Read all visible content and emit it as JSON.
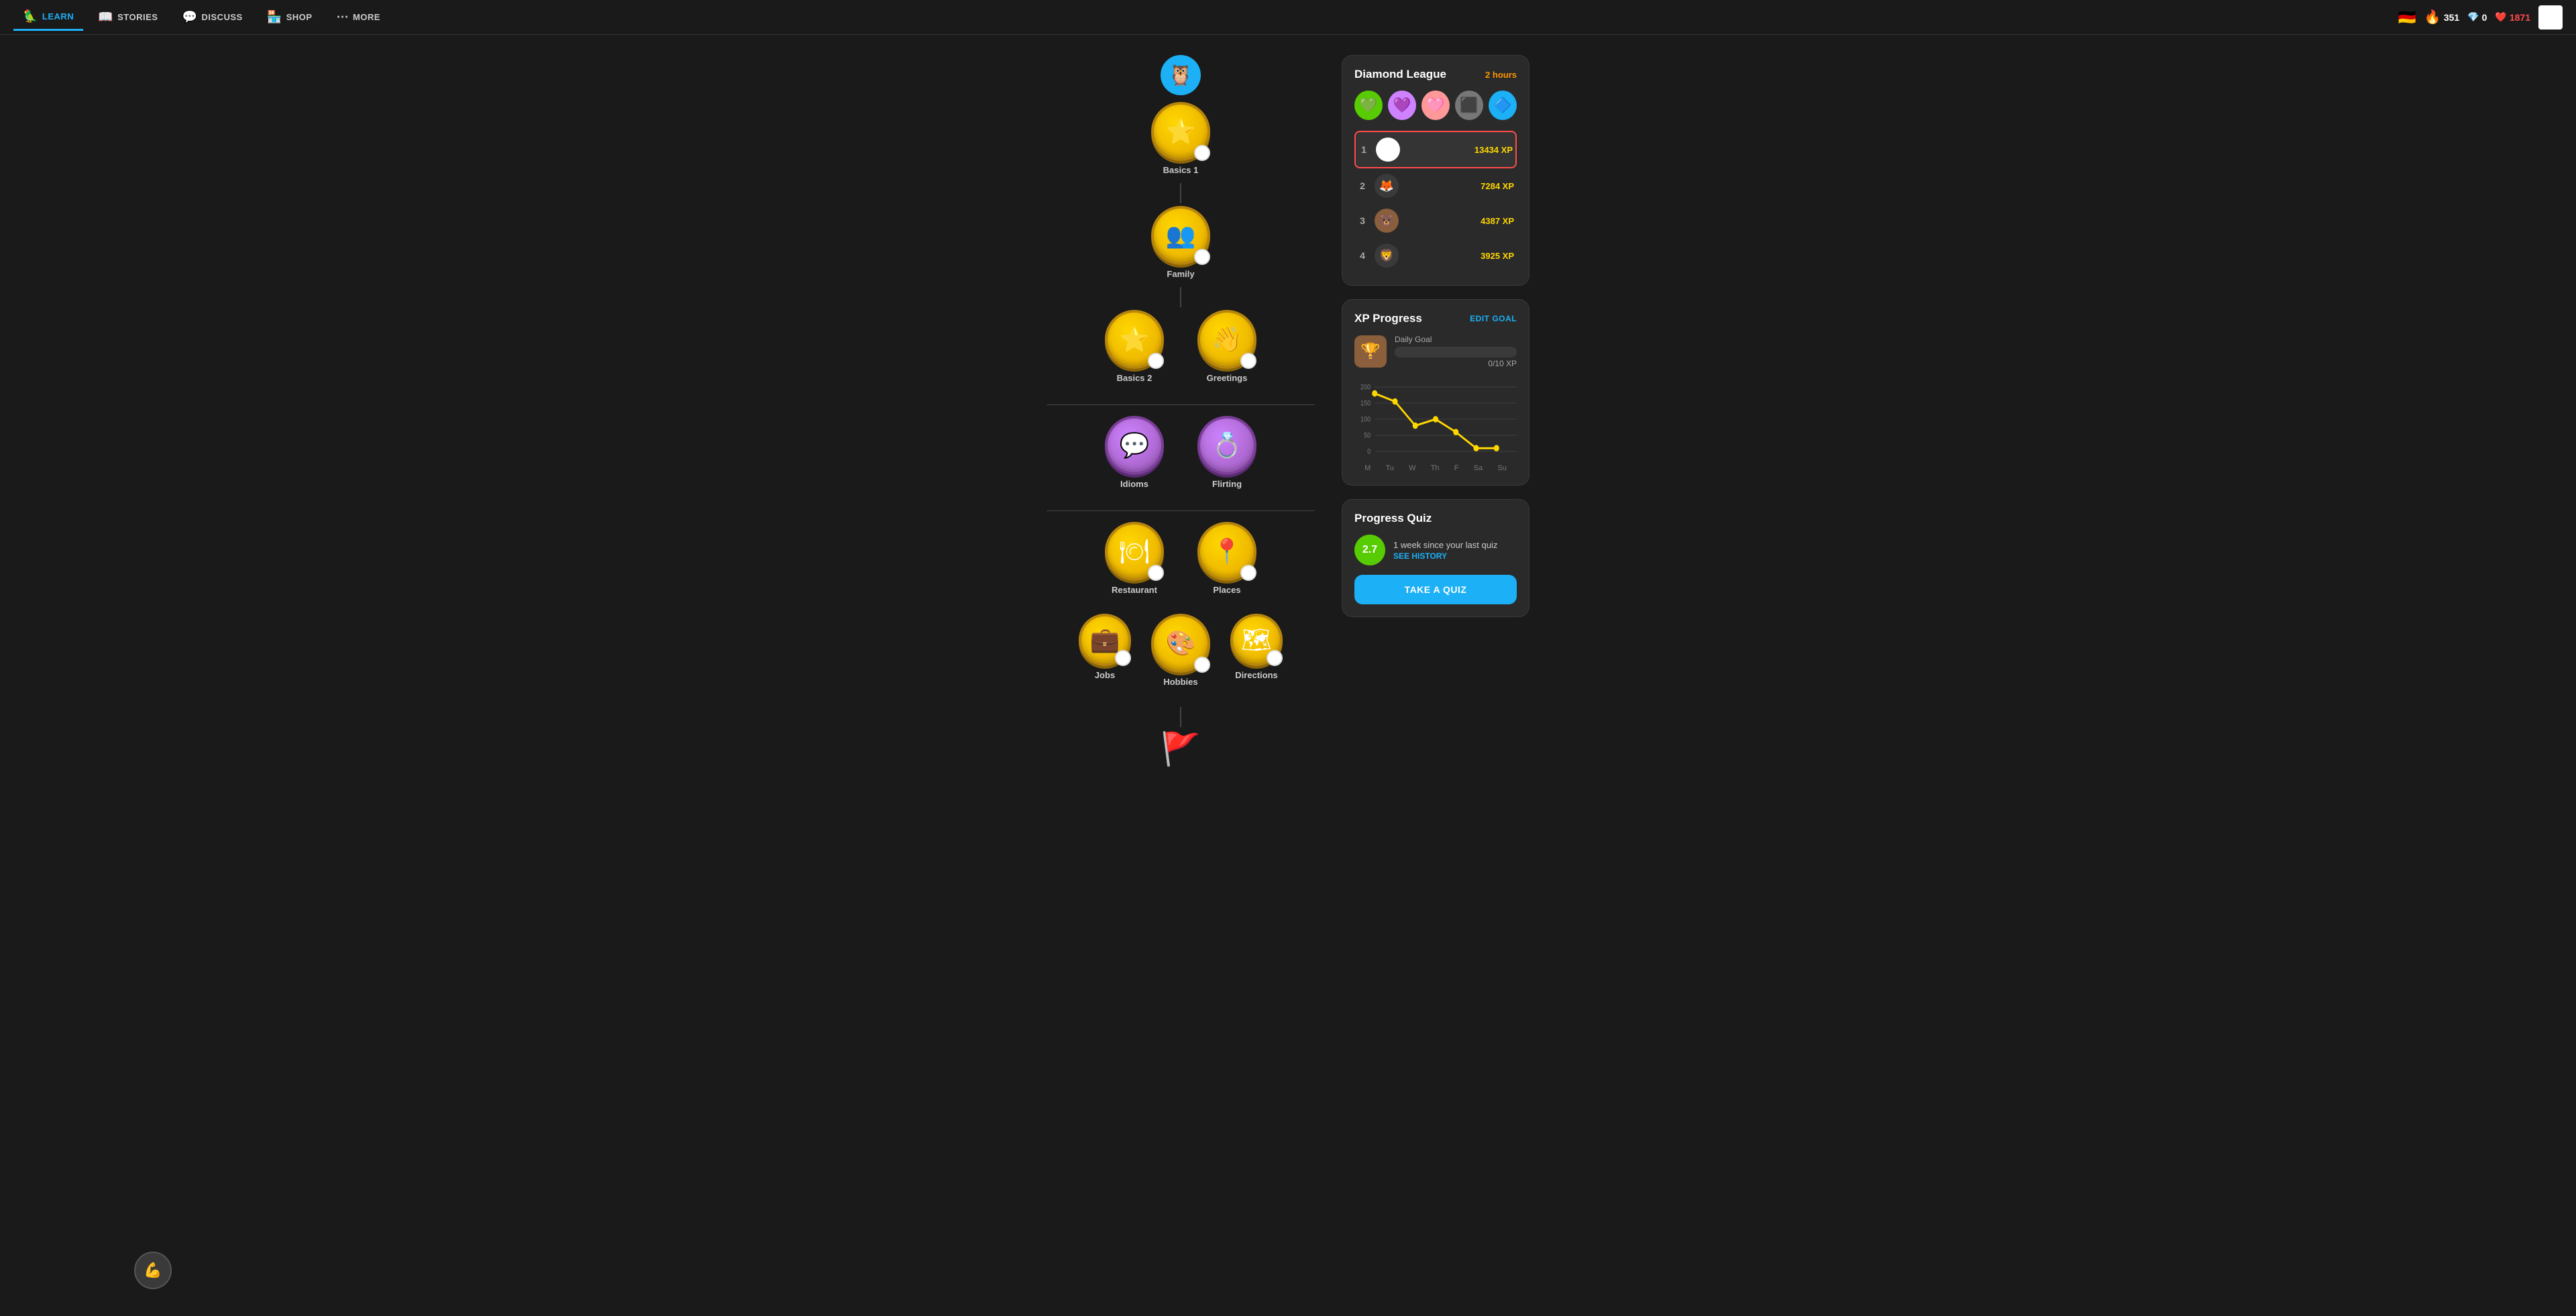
{
  "nav": {
    "items": [
      {
        "id": "learn",
        "label": "LEARN",
        "icon": "🦜",
        "active": true
      },
      {
        "id": "stories",
        "label": "STORIES",
        "icon": "📖"
      },
      {
        "id": "discuss",
        "label": "DISCUSS",
        "icon": "💬"
      },
      {
        "id": "shop",
        "label": "SHOP",
        "icon": "🏪"
      },
      {
        "id": "more",
        "label": "MORE",
        "icon": "···"
      }
    ],
    "streak": {
      "value": "351",
      "icon": "🔥"
    },
    "gems": {
      "value": "0",
      "icon": "💎"
    },
    "health": {
      "value": "1871",
      "icon": "❤️"
    },
    "flag": "🇩🇪"
  },
  "course": {
    "skills": [
      {
        "id": "basics1",
        "label": "Basics 1",
        "type": "gold",
        "icon": "⭐",
        "position": "center"
      },
      {
        "id": "family",
        "label": "Family",
        "type": "gold",
        "icon": "👥",
        "position": "center"
      },
      {
        "id": "basics2",
        "label": "Basics 2",
        "type": "gold",
        "icon": "⭐",
        "position": "left"
      },
      {
        "id": "greetings",
        "label": "Greetings",
        "type": "gold",
        "icon": "👋",
        "position": "right"
      },
      {
        "id": "idioms",
        "label": "Idioms",
        "type": "purple",
        "icon": "💬",
        "position": "left"
      },
      {
        "id": "flirting",
        "label": "Flirting",
        "type": "purple",
        "icon": "💍",
        "position": "right"
      },
      {
        "id": "restaurant",
        "label": "Restaurant",
        "type": "gold",
        "icon": "🍽",
        "position": "left"
      },
      {
        "id": "places",
        "label": "Places",
        "type": "gold",
        "icon": "📍",
        "position": "right"
      },
      {
        "id": "jobs",
        "label": "Jobs",
        "type": "gold",
        "icon": "💼",
        "position": "left"
      },
      {
        "id": "hobbies",
        "label": "Hobbies",
        "type": "gold",
        "icon": "🎨",
        "position": "center"
      },
      {
        "id": "directions",
        "label": "Directions",
        "type": "gold",
        "icon": "🗺",
        "position": "right"
      }
    ]
  },
  "diamond_league": {
    "title": "Diamond League",
    "timer": "2 hours",
    "avatars": [
      "🟢",
      "🟣",
      "🟤",
      "⚫",
      "🔵"
    ],
    "leaderboard": [
      {
        "rank": "1",
        "xp": "13434 XP"
      },
      {
        "rank": "2",
        "xp": "7284 XP"
      },
      {
        "rank": "3",
        "xp": "4387 XP"
      },
      {
        "rank": "4",
        "xp": "3925 XP"
      }
    ]
  },
  "xp_progress": {
    "title": "XP Progress",
    "edit_goal_label": "EDIT GOAL",
    "daily_goal_label": "Daily Goal",
    "daily_goal_value": "0/10 XP",
    "chart": {
      "y_labels": [
        "200",
        "150",
        "100",
        "50",
        "0"
      ],
      "x_labels": [
        "M",
        "Tu",
        "W",
        "Th",
        "F",
        "Sa",
        "Su"
      ],
      "data": [
        180,
        155,
        80,
        100,
        60,
        10,
        10
      ]
    }
  },
  "progress_quiz": {
    "title": "Progress Quiz",
    "score": "2.7",
    "description": "1 week since your last quiz",
    "see_history_label": "SEE HISTORY",
    "take_quiz_label": "TAKE A QUIZ"
  }
}
